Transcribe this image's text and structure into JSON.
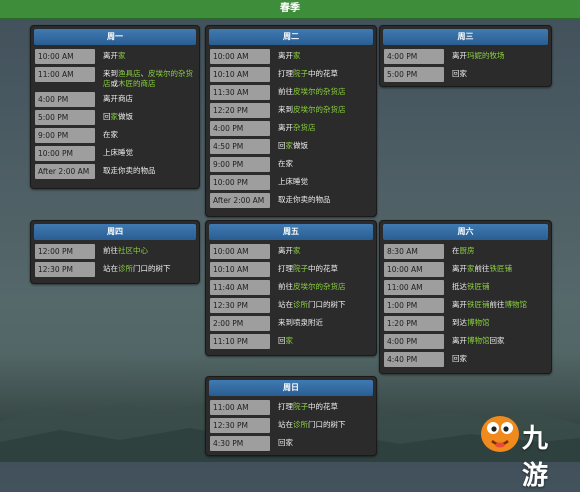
{
  "season": "春季",
  "days": [
    {
      "id": "mon",
      "name": "周一",
      "rows": [
        {
          "time": "10:00 AM",
          "parts": [
            [
              "离开",
              ""
            ],
            [
              "家",
              "hl"
            ]
          ]
        },
        {
          "time": "11:00 AM",
          "parts": [
            [
              "来到",
              ""
            ],
            [
              "渔具店",
              "hl"
            ],
            [
              "、",
              ""
            ],
            [
              "皮埃尔的杂货店",
              "hl"
            ],
            [
              "或",
              ""
            ],
            [
              "木匠的商店",
              "hl"
            ]
          ]
        },
        {
          "time": "4:00 PM",
          "parts": [
            [
              "离开商店",
              ""
            ]
          ]
        },
        {
          "time": "5:00 PM",
          "parts": [
            [
              "回",
              ""
            ],
            [
              "家",
              "hl"
            ],
            [
              "做饭",
              ""
            ]
          ]
        },
        {
          "time": "9:00 PM",
          "parts": [
            [
              "在家",
              ""
            ]
          ]
        },
        {
          "time": "10:00 PM",
          "parts": [
            [
              "上床睡觉",
              ""
            ]
          ]
        },
        {
          "time": "After 2:00 AM",
          "parts": [
            [
              "取走你卖的物品",
              ""
            ]
          ]
        }
      ]
    },
    {
      "id": "tue",
      "name": "周二",
      "rows": [
        {
          "time": "10:00 AM",
          "parts": [
            [
              "离开",
              ""
            ],
            [
              "家",
              "hl"
            ]
          ]
        },
        {
          "time": "10:10 AM",
          "parts": [
            [
              "打理",
              ""
            ],
            [
              "院子",
              "hl"
            ],
            [
              "中的花草",
              ""
            ]
          ]
        },
        {
          "time": "11:30 AM",
          "parts": [
            [
              "前往",
              ""
            ],
            [
              "皮埃尔的杂货店",
              "hl"
            ]
          ]
        },
        {
          "time": "12:20 PM",
          "parts": [
            [
              "来到",
              ""
            ],
            [
              "皮埃尔的杂货店",
              "hl"
            ]
          ]
        },
        {
          "time": "4:00 PM",
          "parts": [
            [
              "离开",
              ""
            ],
            [
              "杂货店",
              "hl"
            ]
          ]
        },
        {
          "time": "4:50 PM",
          "parts": [
            [
              "回",
              ""
            ],
            [
              "家",
              "hl"
            ],
            [
              "做饭",
              ""
            ]
          ]
        },
        {
          "time": "9:00 PM",
          "parts": [
            [
              "在家",
              ""
            ]
          ]
        },
        {
          "time": "10:00 PM",
          "parts": [
            [
              "上床睡觉",
              ""
            ]
          ]
        },
        {
          "time": "After 2:00 AM",
          "parts": [
            [
              "取走你卖的物品",
              ""
            ]
          ]
        }
      ]
    },
    {
      "id": "wed",
      "name": "周三",
      "rows": [
        {
          "time": "4:00 PM",
          "parts": [
            [
              "离开",
              ""
            ],
            [
              "玛妮的牧场",
              "hl"
            ]
          ]
        },
        {
          "time": "5:00 PM",
          "parts": [
            [
              "回家",
              ""
            ]
          ]
        }
      ]
    },
    {
      "id": "thu",
      "name": "周四",
      "rows": [
        {
          "time": "12:00 PM",
          "parts": [
            [
              "前往",
              ""
            ],
            [
              "社区中心",
              "hl"
            ]
          ]
        },
        {
          "time": "12:30 PM",
          "parts": [
            [
              "站在",
              ""
            ],
            [
              "诊所",
              "hl"
            ],
            [
              "门口的树下",
              ""
            ]
          ]
        }
      ]
    },
    {
      "id": "fri",
      "name": "周五",
      "rows": [
        {
          "time": "10:00 AM",
          "parts": [
            [
              "离开",
              ""
            ],
            [
              "家",
              "hl"
            ]
          ]
        },
        {
          "time": "10:10 AM",
          "parts": [
            [
              "打理",
              ""
            ],
            [
              "院子",
              "hl"
            ],
            [
              "中的花草",
              ""
            ]
          ]
        },
        {
          "time": "11:40 AM",
          "parts": [
            [
              "前往",
              ""
            ],
            [
              "皮埃尔的杂货店",
              "hl"
            ]
          ]
        },
        {
          "time": "12:30 PM",
          "parts": [
            [
              "站在",
              ""
            ],
            [
              "诊所",
              "hl"
            ],
            [
              "门口的树下",
              ""
            ]
          ]
        },
        {
          "time": "2:00 PM",
          "parts": [
            [
              "来到喷泉附近",
              ""
            ]
          ]
        },
        {
          "time": "11:10 PM",
          "parts": [
            [
              "回",
              ""
            ],
            [
              "家",
              "hl"
            ]
          ]
        }
      ]
    },
    {
      "id": "sat",
      "name": "周六",
      "rows": [
        {
          "time": "8:30 AM",
          "parts": [
            [
              "在",
              ""
            ],
            [
              "厨房",
              "hl"
            ]
          ]
        },
        {
          "time": "10:00 AM",
          "parts": [
            [
              "离开",
              ""
            ],
            [
              "家",
              "hl"
            ],
            [
              "前往",
              ""
            ],
            [
              "铁匠铺",
              "hl"
            ]
          ]
        },
        {
          "time": "11:00 AM",
          "parts": [
            [
              "抵达",
              ""
            ],
            [
              "铁匠铺",
              "hl"
            ]
          ]
        },
        {
          "time": "1:00 PM",
          "parts": [
            [
              "离开",
              ""
            ],
            [
              "铁匠铺",
              "hl"
            ],
            [
              "前往",
              ""
            ],
            [
              "博物馆",
              "hl"
            ]
          ]
        },
        {
          "time": "1:20 PM",
          "parts": [
            [
              "到达",
              ""
            ],
            [
              "博物馆",
              "hl"
            ]
          ]
        },
        {
          "time": "4:00 PM",
          "parts": [
            [
              "离开",
              ""
            ],
            [
              "博物馆",
              "hl"
            ],
            [
              "回家",
              ""
            ]
          ]
        },
        {
          "time": "4:40 PM",
          "parts": [
            [
              "回家",
              ""
            ]
          ]
        }
      ]
    },
    {
      "id": "sun",
      "name": "周日",
      "rows": [
        {
          "time": "11:00 AM",
          "parts": [
            [
              "打理",
              ""
            ],
            [
              "院子",
              "hl"
            ],
            [
              "中的花草",
              ""
            ]
          ]
        },
        {
          "time": "12:30 PM",
          "parts": [
            [
              "站在",
              ""
            ],
            [
              "诊所",
              "hl"
            ],
            [
              "门口的树下",
              ""
            ]
          ]
        },
        {
          "time": "4:30 PM",
          "parts": [
            [
              "回家",
              ""
            ]
          ]
        }
      ]
    }
  ],
  "logo": {
    "text": "九游",
    "icon": "mascot-icon"
  },
  "colors": {
    "header": "#3e8d3a",
    "day_head": "#2f6aa3",
    "highlight": "#8bd23e",
    "time_bg": "#9e9e9e"
  }
}
